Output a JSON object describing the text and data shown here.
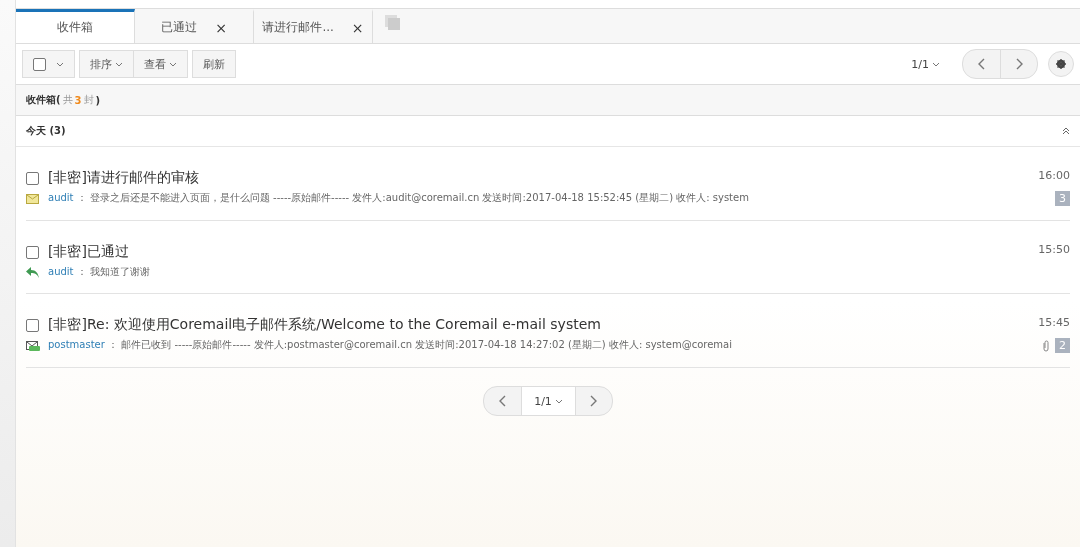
{
  "tabs": [
    {
      "label": "收件箱",
      "selected": true,
      "closable": false
    },
    {
      "label": "已通过",
      "selected": false,
      "closable": true,
      "close": "×"
    },
    {
      "label": "请进行邮件...",
      "selected": false,
      "closable": true,
      "close": "×"
    }
  ],
  "toolbar": {
    "select_all_checked": false,
    "sort": "排序",
    "view": "查看",
    "refresh": "刷新",
    "page": "1/1"
  },
  "folder_header": {
    "name": "收件箱(",
    "total_prefix": "共",
    "count": "3",
    "total_suffix": "封",
    "close_paren": ")"
  },
  "group": {
    "label": "今天 (3)",
    "expanded": true
  },
  "mails": [
    {
      "checked": false,
      "subject": "[非密]请进行邮件的审核",
      "kind": "envelope",
      "sender": "audit",
      "separator": "：",
      "preview": "登录之后还是不能进入页面，是什么问题 -----原始邮件----- 发件人:audit@coremail.cn 发送时间:2017-04-18 15:52:45 (星期二) 收件人: system",
      "time": "16:00",
      "attachment": false,
      "count": "3"
    },
    {
      "checked": false,
      "subject": "[非密]已通过",
      "kind": "reply",
      "sender": "audit",
      "separator": "：",
      "preview": "我知道了谢谢",
      "time": "15:50",
      "attachment": false
    },
    {
      "checked": false,
      "subject": "[非密]Re: 欢迎使用Coremail电子邮件系统/Welcome to the Coremail e-mail system",
      "kind": "envelope-open",
      "sender": "postmaster",
      "separator": "：",
      "preview": "邮件已收到 -----原始邮件----- 发件人:postmaster@coremail.cn 发送时间:2017-04-18 14:27:02 (星期二) 收件人: system@coremai",
      "time": "15:45",
      "attachment": true,
      "count": "2"
    }
  ],
  "pager": {
    "page": "1/1"
  }
}
